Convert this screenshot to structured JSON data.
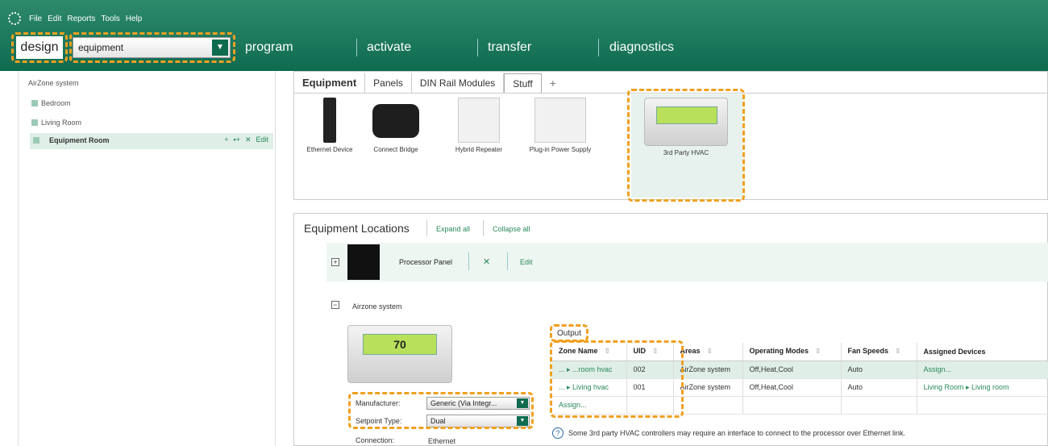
{
  "menu": {
    "items": [
      "File",
      "Edit",
      "Reports",
      "Tools",
      "Help"
    ]
  },
  "nav": {
    "design": "design",
    "selector_value": "equipment",
    "program": "program",
    "activate": "activate",
    "transfer": "transfer",
    "diagnostics": "diagnostics"
  },
  "tree": {
    "root": "AirZone system",
    "items": [
      "Bedroom",
      "Living Room"
    ],
    "selected": "Equipment Room",
    "actions": {
      "add": "+",
      "add_device": "▪+",
      "delete": "✕",
      "edit": "Edit"
    }
  },
  "equipment_panel": {
    "tabs": [
      "Equipment",
      "Panels",
      "DIN Rail Modules",
      "Stuff",
      "+"
    ],
    "devices": [
      "Ethernet Device",
      "Connect Bridge",
      "Hybrid Repeater",
      "Plug-in Power Supply",
      "3rd Party HVAC"
    ]
  },
  "locations": {
    "title": "Equipment Locations",
    "expand_all": "Expand all",
    "collapse_all": "Collapse all",
    "processor": {
      "expander": "+",
      "label": "Processor Panel",
      "delete": "✕",
      "edit": "Edit"
    },
    "airzone": {
      "expander": "−",
      "label": "Airzone system"
    },
    "lcd_reading": "70",
    "fields": {
      "manufacturer_label": "Manufacturer:",
      "manufacturer_value": "Generic (Via Integr...",
      "setpoint_label": "Setpoint Type:",
      "setpoint_value": "Dual",
      "connection_label": "Connection:",
      "connection_value": "Ethernet"
    },
    "output_label": "Output",
    "table": {
      "headers": [
        "Zone Name",
        "UID",
        "Areas",
        "Operating Modes",
        "Fan Speeds",
        "Assigned Devices"
      ],
      "sort_icon": "⇳",
      "rows": [
        {
          "zone": "... ▸ ...room hvac",
          "uid": "002",
          "areas": "AirZone system",
          "modes": "Off,Heat,Cool",
          "fan": "Auto",
          "assigned": "Assign..."
        },
        {
          "zone": "... ▸ Living hvac",
          "uid": "001",
          "areas": "AirZone system",
          "modes": "Off,Heat,Cool",
          "fan": "Auto",
          "assigned": "Living Room ▸ Living room"
        }
      ],
      "assign_link": "Assign..."
    },
    "note": "Some 3rd party HVAC controllers may require an interface to connect to the processor over Ethernet link."
  }
}
